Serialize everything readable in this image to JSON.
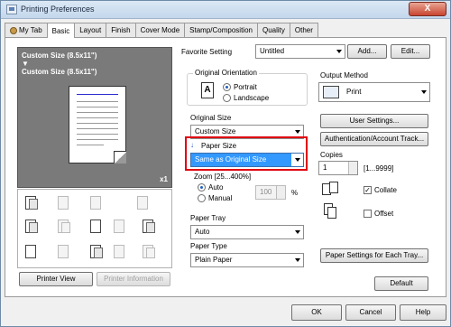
{
  "window": {
    "title": "Printing Preferences",
    "close_label": "X"
  },
  "tabs": [
    "My Tab",
    "Basic",
    "Layout",
    "Finish",
    "Cover Mode",
    "Stamp/Composition",
    "Quality",
    "Other"
  ],
  "preview": {
    "line1": "Custom Size (8.5x11\")",
    "arrow": "▼",
    "line2": "Custom Size (8.5x11\")",
    "copies_mark": "x1"
  },
  "left_buttons": {
    "printer_view": "Printer View",
    "printer_information": "Printer Information"
  },
  "favorite": {
    "label": "Favorite Setting",
    "value": "Untitled",
    "add": "Add...",
    "edit": "Edit..."
  },
  "orientation": {
    "title": "Original Orientation",
    "portrait": "Portrait",
    "landscape": "Landscape",
    "icon_letter": "A"
  },
  "original_size": {
    "label": "Original Size",
    "value": "Custom Size"
  },
  "paper_size": {
    "label": "Paper Size",
    "value": "Same as Original Size"
  },
  "zoom": {
    "label": "Zoom [25...400%]",
    "auto": "Auto",
    "manual": "Manual",
    "value": "100",
    "unit": "%"
  },
  "paper_tray": {
    "label": "Paper Tray",
    "value": "Auto"
  },
  "paper_type": {
    "label": "Paper Type",
    "value": "Plain Paper"
  },
  "output": {
    "label": "Output Method",
    "value": "Print"
  },
  "buttons": {
    "user_settings": "User Settings...",
    "auth": "Authentication/Account Track...",
    "paper_settings": "Paper Settings for Each Tray...",
    "default": "Default"
  },
  "copies": {
    "label": "Copies",
    "value": "1",
    "range": "[1...9999]",
    "collate": "Collate",
    "offset": "Offset"
  },
  "bottom": {
    "ok": "OK",
    "cancel": "Cancel",
    "help": "Help"
  }
}
